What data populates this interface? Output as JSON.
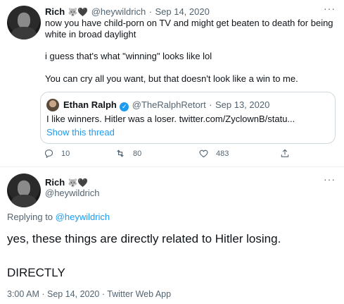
{
  "tweet1": {
    "name": "Rich",
    "badge_emoji": "🐺",
    "badge_heart": "🖤",
    "handle": "@heywildrich",
    "dot": "·",
    "date": "Sep 14, 2020",
    "more": "···",
    "text_line1": "now you have child-porn on TV and might get beaten to death for being",
    "text_line2": "white in broad daylight",
    "text_line3": "i guess that's what \"winning\" looks like lol",
    "text_line4": "You can cry all you want, but that doesn't look like a win to me.",
    "quote": {
      "name": "Ethan Ralph",
      "handle": "@TheRalphRetort",
      "dot": "·",
      "date": "Sep 13, 2020",
      "text": "I like winners. Hitler was a loser. twitter.com/ZyclownB/statu...",
      "show_thread": "Show this thread"
    },
    "actions": {
      "replies": "10",
      "retweets": "80",
      "likes": "483"
    }
  },
  "tweet2": {
    "name": "Rich",
    "badge_emoji": "🐺",
    "badge_heart": "🖤",
    "handle": "@heywildrich",
    "more": "···",
    "replying_prefix": "Replying to ",
    "replying_handle": "@heywildrich",
    "text_line1": "yes, these things are directly related to Hitler losing.",
    "text_line2": "DIRECTLY",
    "time": "3:00 AM",
    "dot1": "·",
    "date": "Sep 14, 2020",
    "dot2": "·",
    "source": "Twitter Web App"
  },
  "icons": [
    "reply-icon",
    "retweet-icon",
    "like-icon",
    "share-icon",
    "verified-icon"
  ],
  "colors": {
    "link": "#1d9bf0",
    "muted": "#536471",
    "border": "#cfd9de"
  }
}
